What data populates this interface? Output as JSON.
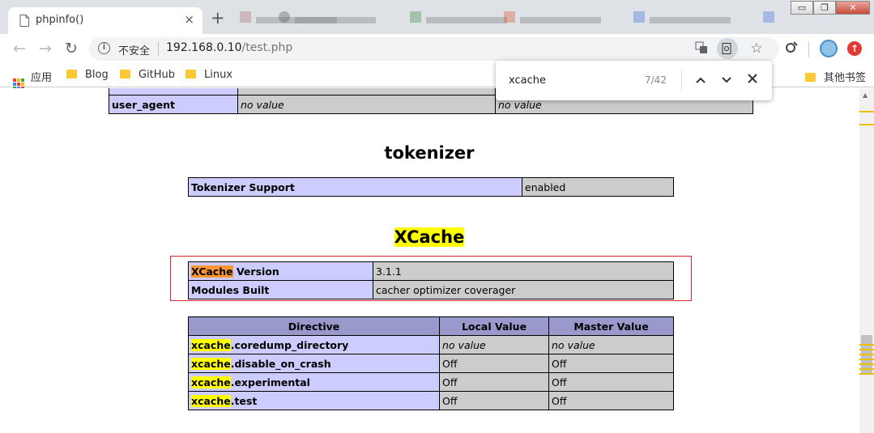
{
  "browser": {
    "tab_title": "phpinfo()",
    "tab_close": "×",
    "new_tab": "+",
    "window_controls": {
      "minimize": "▭",
      "restore": "❐",
      "close": "✕"
    },
    "insecure_label": "不安全",
    "url_host": "192.168.0.10",
    "url_path": "/test.php",
    "nav": {
      "back": "←",
      "forward": "→",
      "reload": "↻"
    }
  },
  "bookmarks": {
    "apps": "应用",
    "items": [
      "Blog",
      "GitHub",
      "Linux"
    ],
    "other": "其他书签"
  },
  "find": {
    "query": "xcache",
    "count": "7/42",
    "prev": "︿",
    "next": "﹀",
    "close": "✕"
  },
  "page": {
    "prev_table": {
      "row_label": "user_agent",
      "local": "no value",
      "master": "no value"
    },
    "tokenizer": {
      "heading": "tokenizer",
      "rows": [
        {
          "label": "Tokenizer Support",
          "value": "enabled"
        }
      ]
    },
    "xcache": {
      "heading": "XCache",
      "info_rows": [
        {
          "hl": "XCache",
          "rest": " Version",
          "value": "3.1.1"
        },
        {
          "hl": "",
          "rest": "Modules Built",
          "value": "cacher optimizer coverager"
        }
      ],
      "headers": [
        "Directive",
        "Local Value",
        "Master Value"
      ],
      "directives": [
        {
          "hl": "xcache",
          "rest": ".coredump_directory",
          "local": "no value",
          "master": "no value"
        },
        {
          "hl": "xcache",
          "rest": ".disable_on_crash",
          "local": "Off",
          "master": "Off"
        },
        {
          "hl": "xcache",
          "rest": ".experimental",
          "local": "Off",
          "master": "Off"
        },
        {
          "hl": "xcache",
          "rest": ".test",
          "local": "Off",
          "master": "Off"
        }
      ]
    }
  },
  "colors": {
    "header_bg": "#9999cc",
    "label_bg": "#ccccff",
    "value_bg": "#cccccc",
    "find_highlight": "#ffff00",
    "find_current": "#ff9632",
    "annotation_box": "#e0252a"
  }
}
